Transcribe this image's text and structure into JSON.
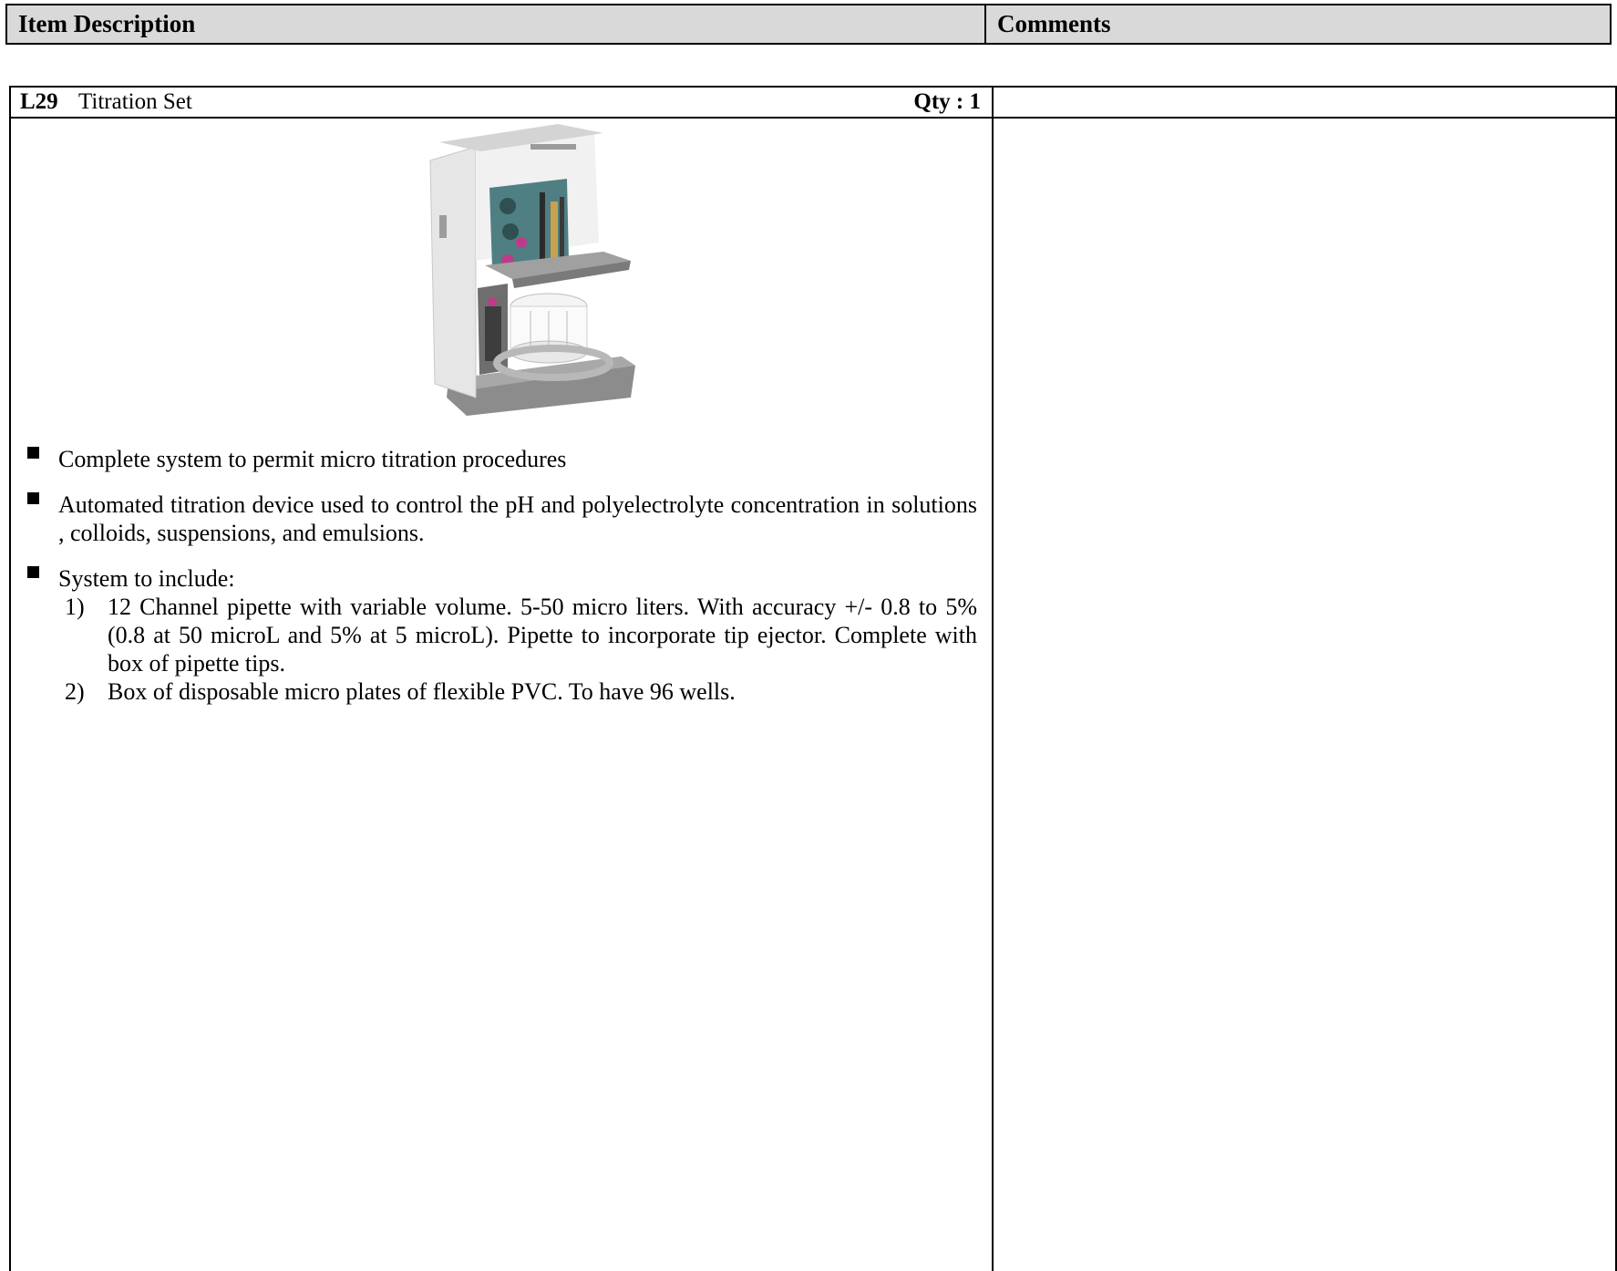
{
  "header": {
    "description_label": "Item Description",
    "comments_label": "Comments"
  },
  "item": {
    "code": "L29",
    "name": "Titration Set",
    "qty": "Qty : 1",
    "image_alt": "titration-device-photo",
    "bullets": [
      "Complete system to permit micro titration procedures",
      "Automated titration device used to control the pH and  polyelectrolyte concentration in solutions , colloids, suspensions, and emulsions.",
      "System to include:"
    ],
    "sub_items": [
      {
        "num": "1)",
        "text": "12 Channel pipette with variable volume. 5-50 micro liters. With accuracy +/- 0.8 to 5% (0.8 at 50 microL and 5% at 5 microL). Pipette to incorporate tip ejector. Complete with box of pipette tips."
      },
      {
        "num": "2)",
        "text": "Box of disposable micro plates of flexible PVC. To have 96 wells."
      }
    ]
  },
  "comments": {
    "text": ""
  },
  "colors": {
    "header_bg": "#d9d9d9",
    "border": "#000000"
  }
}
